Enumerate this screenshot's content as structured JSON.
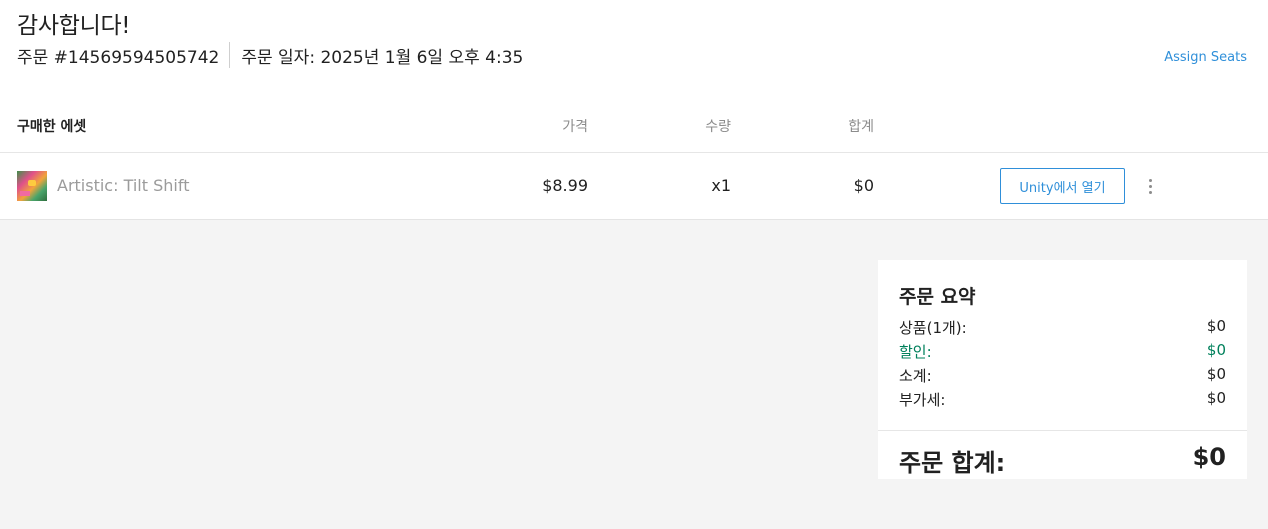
{
  "header": {
    "title": "감사합니다!",
    "order_number": "주문 #14569594505742",
    "order_date": "주문 일자: 2025년 1월 6일 오후 4:35",
    "assign_seats": "Assign Seats"
  },
  "table": {
    "columns": {
      "asset": "구매한 에셋",
      "price": "가격",
      "quantity": "수량",
      "total": "합계"
    },
    "rows": [
      {
        "name": "Artistic: Tilt Shift",
        "price": "$8.99",
        "quantity": "x1",
        "total": "$0",
        "open_button": "Unity에서 열기",
        "thumbnail_icon": "asset-thumbnail"
      }
    ]
  },
  "summary": {
    "title": "주문 요약",
    "items_label": "상품(1개):",
    "items_value": "$0",
    "discount_label": "할인:",
    "discount_value": "$0",
    "subtotal_label": "소계:",
    "subtotal_value": "$0",
    "tax_label": "부가세:",
    "tax_value": "$0",
    "total_label": "주문 합계:",
    "total_value": "$0"
  },
  "colors": {
    "accent": "#2f8fd9",
    "discount": "#00805b",
    "background": "#f4f4f4"
  }
}
